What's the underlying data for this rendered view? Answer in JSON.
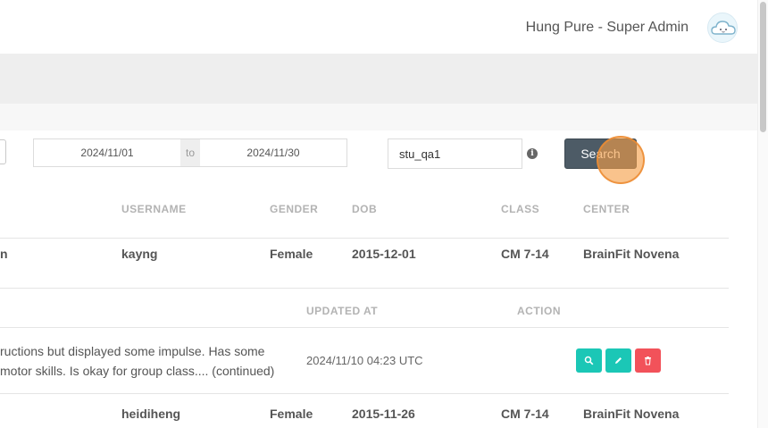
{
  "header": {
    "user_label": "Hung Pure - Super Admin"
  },
  "filters": {
    "date_from": "2024/11/01",
    "date_sep": "to",
    "date_to": "2024/11/30",
    "search_value": "stu_qa1",
    "search_button": "Search"
  },
  "table": {
    "headers": {
      "name_partial": "",
      "username": "USERNAME",
      "gender": "GENDER",
      "dob": "DOB",
      "class": "CLASS",
      "center": "CENTER"
    },
    "rows": [
      {
        "name_partial": "n",
        "username": "kayng",
        "gender": "Female",
        "dob": "2015-12-01",
        "class": "CM 7-14",
        "center": "BrainFit Novena"
      },
      {
        "name_partial": "",
        "username": "heidiheng",
        "gender": "Female",
        "dob": "2015-11-26",
        "class": "CM 7-14",
        "center": "BrainFit Novena"
      }
    ]
  },
  "notes": {
    "headers": {
      "updated_at": "UPDATED AT",
      "action": "ACTION"
    },
    "item": {
      "line1": "ructions but displayed some impulse. Has some",
      "line2": "motor skills. Is okay for group class.... (continued)",
      "updated_at": "2024/11/10 04:23 UTC"
    }
  },
  "colors": {
    "teal": "#1bc7b6",
    "red": "#f2525a",
    "dark_button": "#4d5b66"
  },
  "icons": {
    "avatar": "cloud-avatar-icon",
    "info": "info-icon",
    "view": "search-icon",
    "edit": "pencil-icon",
    "delete": "trash-icon"
  }
}
